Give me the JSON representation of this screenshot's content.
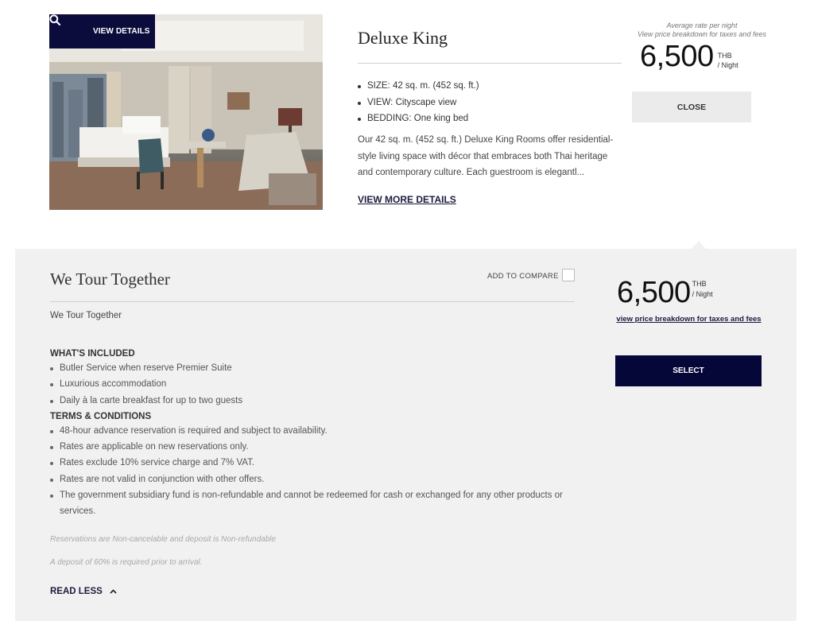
{
  "room": {
    "view_details_label": "VIEW DETAILS",
    "title": "Deluxe King",
    "facts": [
      "SIZE: 42 sq. m. (452 sq. ft.)",
      "VIEW: Cityscape view",
      "BEDDING: One king bed"
    ],
    "description": "Our 42 sq. m. (452 sq. ft.) Deluxe King Rooms offer residential-style living space with décor that embraces both Thai heritage and contemporary culture. Each guestroom is elegantl...",
    "view_more_label": "VIEW MORE DETAILS",
    "rate_caption_line1": "Average rate per night",
    "rate_caption_line2": "View price breakdown for taxes and fees",
    "price": "6,500",
    "currency": "THB",
    "per_night": "/ Night",
    "close_label": "CLOSE"
  },
  "rate_plan": {
    "title": "We Tour Together",
    "compare_label": "ADD TO COMPARE",
    "subtitle": "We Tour Together",
    "included_heading": "WHAT'S INCLUDED",
    "included": [
      "Butler Service when reserve Premier Suite",
      "Luxurious accommodation",
      "Daily à la carte breakfast for up to two guests"
    ],
    "terms_heading": "TERMS & CONDITIONS",
    "terms": [
      "48-hour advance reservation is required and subject to availability.",
      "Rates are applicable on new reservations only.",
      "Rates exclude 10% service charge and 7% VAT.",
      "Rates are not valid in conjunction with other offers.",
      "The government subsidiary fund is non-refundable and cannot be redeemed for cash or exchanged for any other products or services."
    ],
    "note_cancel": "Reservations are Non-cancelable and deposit is Non-refundable",
    "note_deposit": "A deposit of 60% is required prior to arrival.",
    "read_less_label": "READ LESS",
    "price": "6,500",
    "currency": "THB",
    "per_night": "/ Night",
    "breakdown_link": "view price breakdown for taxes and fees",
    "select_label": "SELECT"
  },
  "icons": {
    "search": "search-icon",
    "chevron": "chevron-up-icon"
  },
  "colors": {
    "navy": "#0b0c3b",
    "panel_bg": "#f1f1f1",
    "close_bg": "#ebebeb"
  }
}
